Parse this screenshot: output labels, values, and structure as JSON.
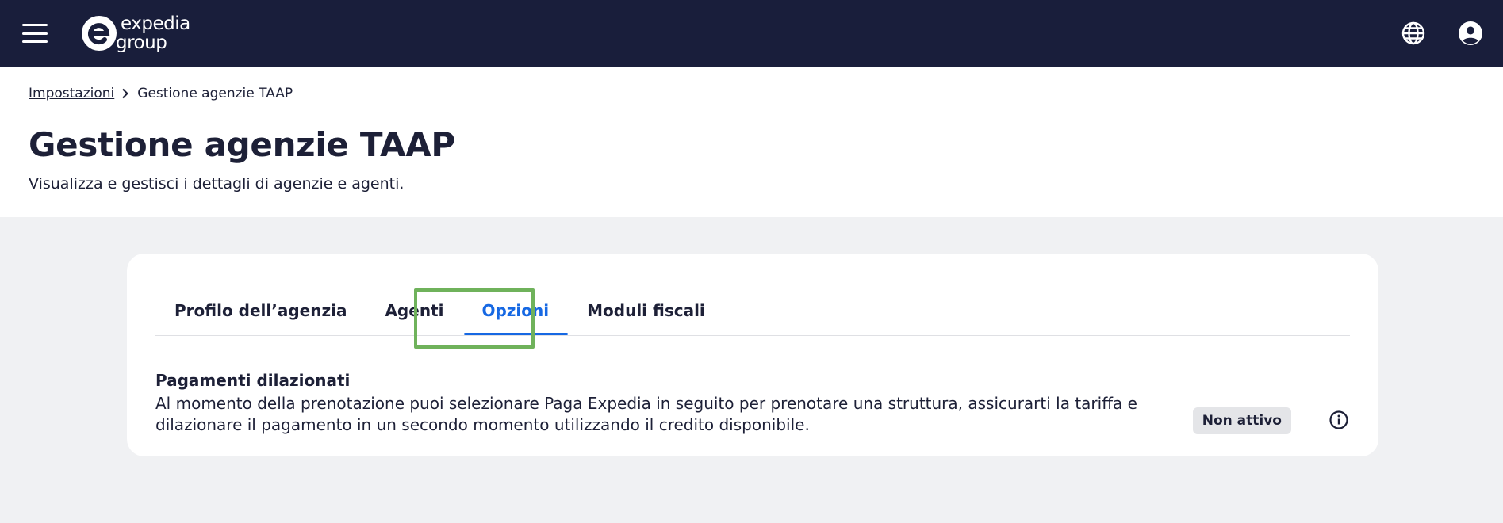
{
  "header": {
    "logo_line1": "expedia",
    "logo_line2": "group"
  },
  "icons": {
    "menu": "hamburger-menu-icon",
    "language": "globe-icon",
    "account": "account-circle-icon",
    "breadcrumb_separator": "chevron-right-icon",
    "info": "info-icon"
  },
  "breadcrumb": {
    "parent": "Impostazioni",
    "current": "Gestione agenzie TAAP"
  },
  "page": {
    "title": "Gestione agenzie TAAP",
    "subtitle": "Visualizza e gestisci i dettagli di agenzie e agenti."
  },
  "tabs": [
    {
      "label": "Profilo dell’agenzia",
      "active": false
    },
    {
      "label": "Agenti",
      "active": false
    },
    {
      "label": "Opzioni",
      "active": true
    },
    {
      "label": "Moduli fiscali",
      "active": false
    }
  ],
  "deferred_payments": {
    "title": "Pagamenti dilazionati",
    "description": "Al momento della prenotazione puoi selezionare Paga Expedia in seguito per prenotare una struttura, assicurarti la tariffa e dilazionare il pagamento in un secondo momento utilizzando il credito disponibile.",
    "status": "Non attivo"
  },
  "colors": {
    "topbar": "#191e3b",
    "accent": "#1668e3",
    "focus_outline": "#6fb25b",
    "page_background": "#f0f1f3"
  }
}
